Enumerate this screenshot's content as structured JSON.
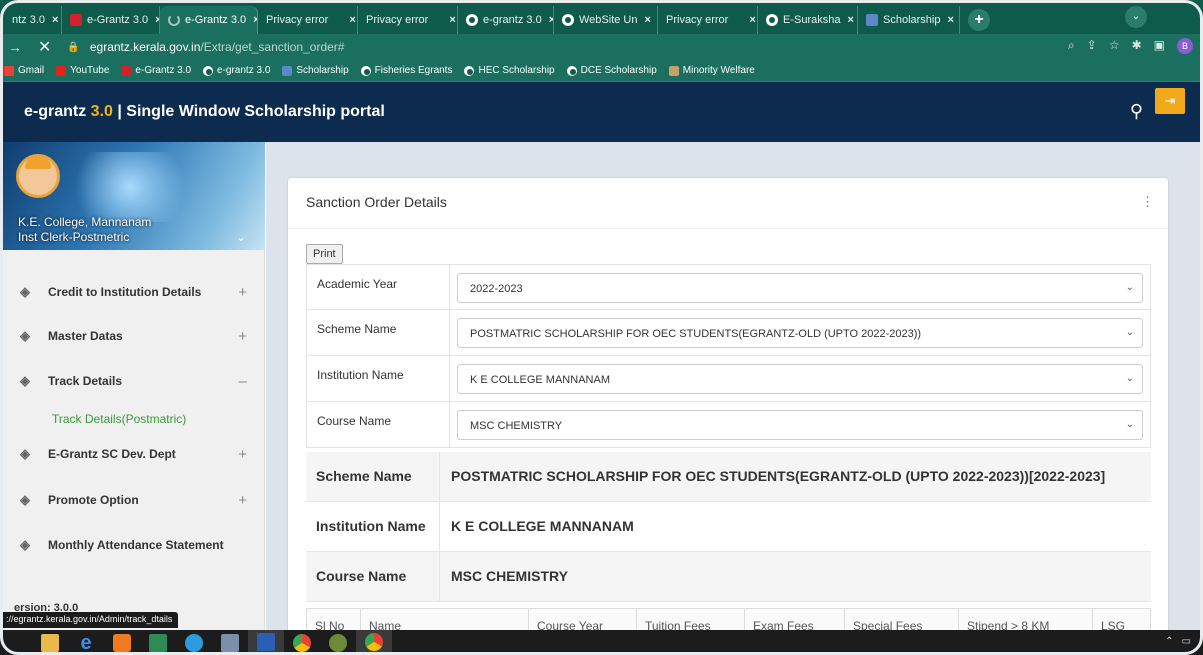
{
  "browser": {
    "tabs": [
      {
        "label": "ntz 3.0",
        "icon": "none"
      },
      {
        "label": "e-Grantz 3.0",
        "icon": "red"
      },
      {
        "label": "e-Grantz 3.0",
        "icon": "spin",
        "active": true
      },
      {
        "label": "Privacy error",
        "icon": "none"
      },
      {
        "label": "Privacy error",
        "icon": "none"
      },
      {
        "label": "e-grantz 3.0",
        "icon": "globe"
      },
      {
        "label": "WebSite Un",
        "icon": "globe"
      },
      {
        "label": "Privacy error",
        "icon": "none"
      },
      {
        "label": "E-Suraksha",
        "icon": "globe"
      },
      {
        "label": "Scholarship",
        "icon": "doc"
      }
    ],
    "new_tab_label": "+",
    "url_host": "egrantz.kerala.gov.in",
    "url_path": "/Extra/get_sanction_order#",
    "profile_initial": "B",
    "bookmarks": [
      {
        "label": "Gmail",
        "icon": "gm"
      },
      {
        "label": "YouTube",
        "icon": "yt"
      },
      {
        "label": "e-Grantz 3.0",
        "icon": "red"
      },
      {
        "label": "e-grantz 3.0",
        "icon": "globe"
      },
      {
        "label": "Scholarship",
        "icon": "doc"
      },
      {
        "label": "Fisheries Egrants",
        "icon": "globe"
      },
      {
        "label": "HEC Scholarship",
        "icon": "globe"
      },
      {
        "label": "DCE Scholarship",
        "icon": "globe"
      },
      {
        "label": "Minority Welfare",
        "icon": "img"
      }
    ],
    "status_url": "://egrantz.kerala.gov.in/Admin/track_dtails"
  },
  "header": {
    "brand_prefix": "e-grantz ",
    "brand_version": "3.0",
    "brand_suffix": " | Single Window Scholarship portal"
  },
  "sidebar": {
    "institution": "K.E. College, Mannanam",
    "role": "Inst Clerk-Postmetric",
    "menu": [
      {
        "label": "Credit to Institution Details",
        "sign": "+"
      },
      {
        "label": "Master Datas",
        "sign": "+"
      },
      {
        "label": "Track Details",
        "sign": "–"
      },
      {
        "label": "E-Grantz SC Dev. Dept",
        "sign": "+"
      },
      {
        "label": "Promote Option",
        "sign": "+"
      },
      {
        "label": "Monthly Attendance Statement",
        "sign": ""
      }
    ],
    "submenu_active": "Track Details(Postmatric)",
    "version": "ersion: 3.0.0"
  },
  "main": {
    "card_title": "Sanction Order Details",
    "print_label": "Print",
    "filters": [
      {
        "label": "Academic Year",
        "value": "2022-2023"
      },
      {
        "label": "Scheme Name",
        "value": "POSTMATRIC SCHOLARSHIP FOR OEC STUDENTS(EGRANTZ-OLD (UPTO 2022-2023))"
      },
      {
        "label": "Institution Name",
        "value": "K E COLLEGE MANNANAM"
      },
      {
        "label": "Course Name",
        "value": "MSC CHEMISTRY"
      }
    ],
    "info": [
      {
        "label": "Scheme Name",
        "value": "POSTMATRIC SCHOLARSHIP FOR OEC STUDENTS(EGRANTZ-OLD (UPTO 2022-2023))[2022-2023]"
      },
      {
        "label": "Institution Name",
        "value": "K E COLLEGE MANNANAM"
      },
      {
        "label": "Course Name",
        "value": "MSC CHEMISTRY"
      }
    ],
    "table_headers": [
      "Sl No",
      "Name",
      "Course Year",
      "Tuition Fees",
      "Exam Fees",
      "Special Fees",
      "Stipend > 8 KM",
      "LSG"
    ]
  },
  "taskbar": {
    "apps": [
      "file-explorer",
      "internet-explorer",
      "media-player",
      "excel",
      "edge",
      "calculator",
      "word",
      "chrome",
      "game",
      "chrome-profile"
    ]
  }
}
